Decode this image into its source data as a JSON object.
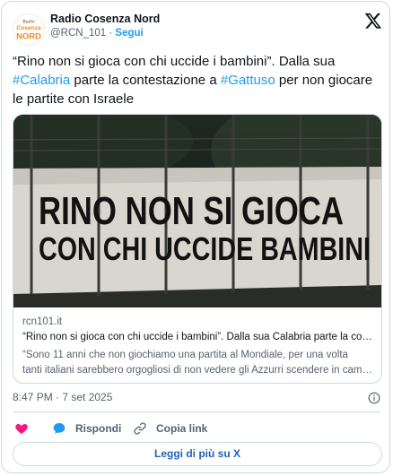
{
  "account": {
    "name": "Radio Cosenza Nord",
    "handle": "@RCN_101",
    "separator": "·",
    "follow_label": "Segui",
    "avatar_text": [
      "Radio",
      "Cosenza",
      "NORD"
    ]
  },
  "tweet": {
    "text_1": "“Rino non si gioca con chi uccide i bambini”. Dalla sua ",
    "hashtag_1": "#Calabria",
    "text_2": "  parte la contestazione a ",
    "hashtag_2": "#Gattuso",
    "text_3": "  per non giocare le partite con Israele"
  },
  "link_card": {
    "image_text": [
      "RINO NON SI GIOCA",
      "CON CHI UCCIDE BAMBINI"
    ],
    "domain": "rcn101.it",
    "title": "“Rino non si gioca con chi uccide i bambini”. Dalla sua Calabria parte la contestazione a Gattuso per non giocare le partite con Israele",
    "description_1": "“Sono 11 anni che non giochiamo una partita al Mondiale, per una volta",
    "description_2": "tanti italiani sarebbero orgogliosi di non vedere gli Azzurri scendere in campo contro Israele”"
  },
  "meta": {
    "time": "8:47 PM · 7 set 2025"
  },
  "actions": {
    "reply_label": "Rispondi",
    "copy_label": "Copia link"
  },
  "read_more_label": "Leggi di più su X",
  "colors": {
    "accent": "#1d9bf0",
    "like": "#f91880",
    "border": "#cfd9de",
    "secondary_text": "#536471"
  }
}
